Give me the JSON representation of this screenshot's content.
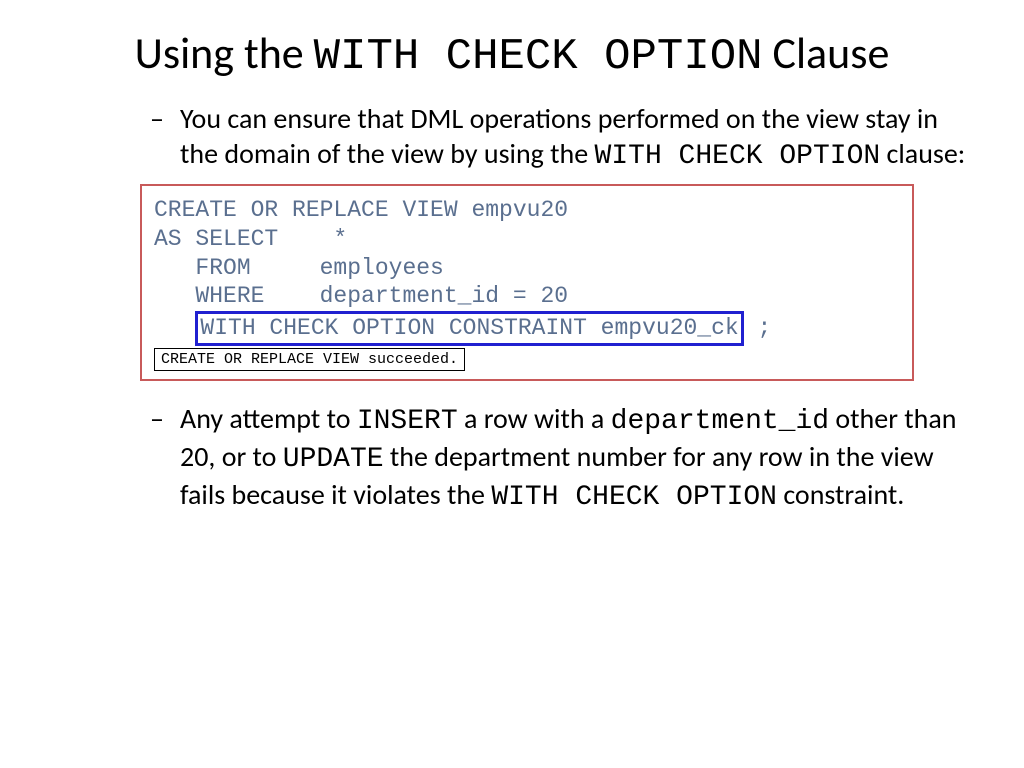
{
  "title": {
    "prefix": "Using the ",
    "code": "WITH CHECK OPTION",
    "suffix": " Clause"
  },
  "bullet1": {
    "part1": "You can ensure that DML operations performed on the view stay in the domain of the view by using the ",
    "code1": "WITH CHECK OPTION",
    "part2": " clause:"
  },
  "code": {
    "line1": "CREATE OR REPLACE VIEW empvu20",
    "line2": "AS SELECT    *",
    "line3": "   FROM     employees",
    "line4": "   WHERE    department_id = 20",
    "line5_prefix": "   ",
    "line5_highlight": "WITH CHECK OPTION CONSTRAINT empvu20_ck",
    "line5_suffix": " ;",
    "status": "CREATE OR REPLACE VIEW succeeded."
  },
  "bullet2": {
    "part1": "Any attempt to ",
    "code1": "INSERT",
    "part2": " a row with a ",
    "code2": "department_id",
    "part3": " other than 20, or to ",
    "code3": "UPDATE",
    "part4": " the department number for any row in the view fails because it violates the ",
    "code4": "WITH CHECK OPTION",
    "part5": " constraint."
  }
}
